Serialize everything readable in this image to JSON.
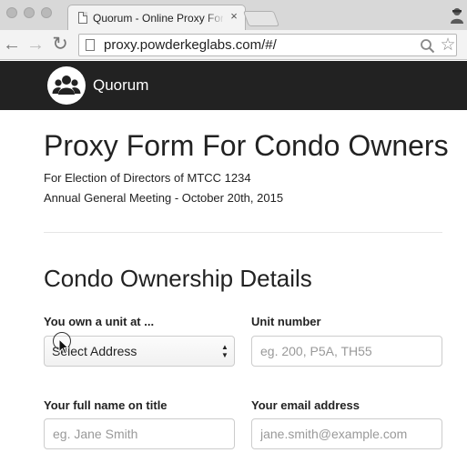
{
  "browser": {
    "tab_title": "Quorum - Online Proxy For",
    "tab_close": "×",
    "url": "proxy.powderkeglabs.com/#/",
    "back": "←",
    "forward": "→",
    "reload": "↻",
    "star": "☆"
  },
  "navbar": {
    "brand_name": "Quorum",
    "logo_icon": "people-group-icon",
    "background": "#222222"
  },
  "page": {
    "title": "Proxy Form For Condo Owners",
    "subtitle_1": "For Election of Directors of MTCC 1234",
    "subtitle_2": "Annual General Meeting - October 20th, 2015",
    "section_title": "Condo Ownership Details"
  },
  "form": {
    "unit_at": {
      "label": "You own a unit at ...",
      "selected": "Select Address"
    },
    "unit_number": {
      "label": "Unit number",
      "placeholder": "eg. 200, P5A, TH55"
    },
    "full_name": {
      "label": "Your full name on title",
      "placeholder": "eg. Jane Smith"
    },
    "email": {
      "label": "Your email address",
      "placeholder": "jane.smith@example.com"
    }
  }
}
